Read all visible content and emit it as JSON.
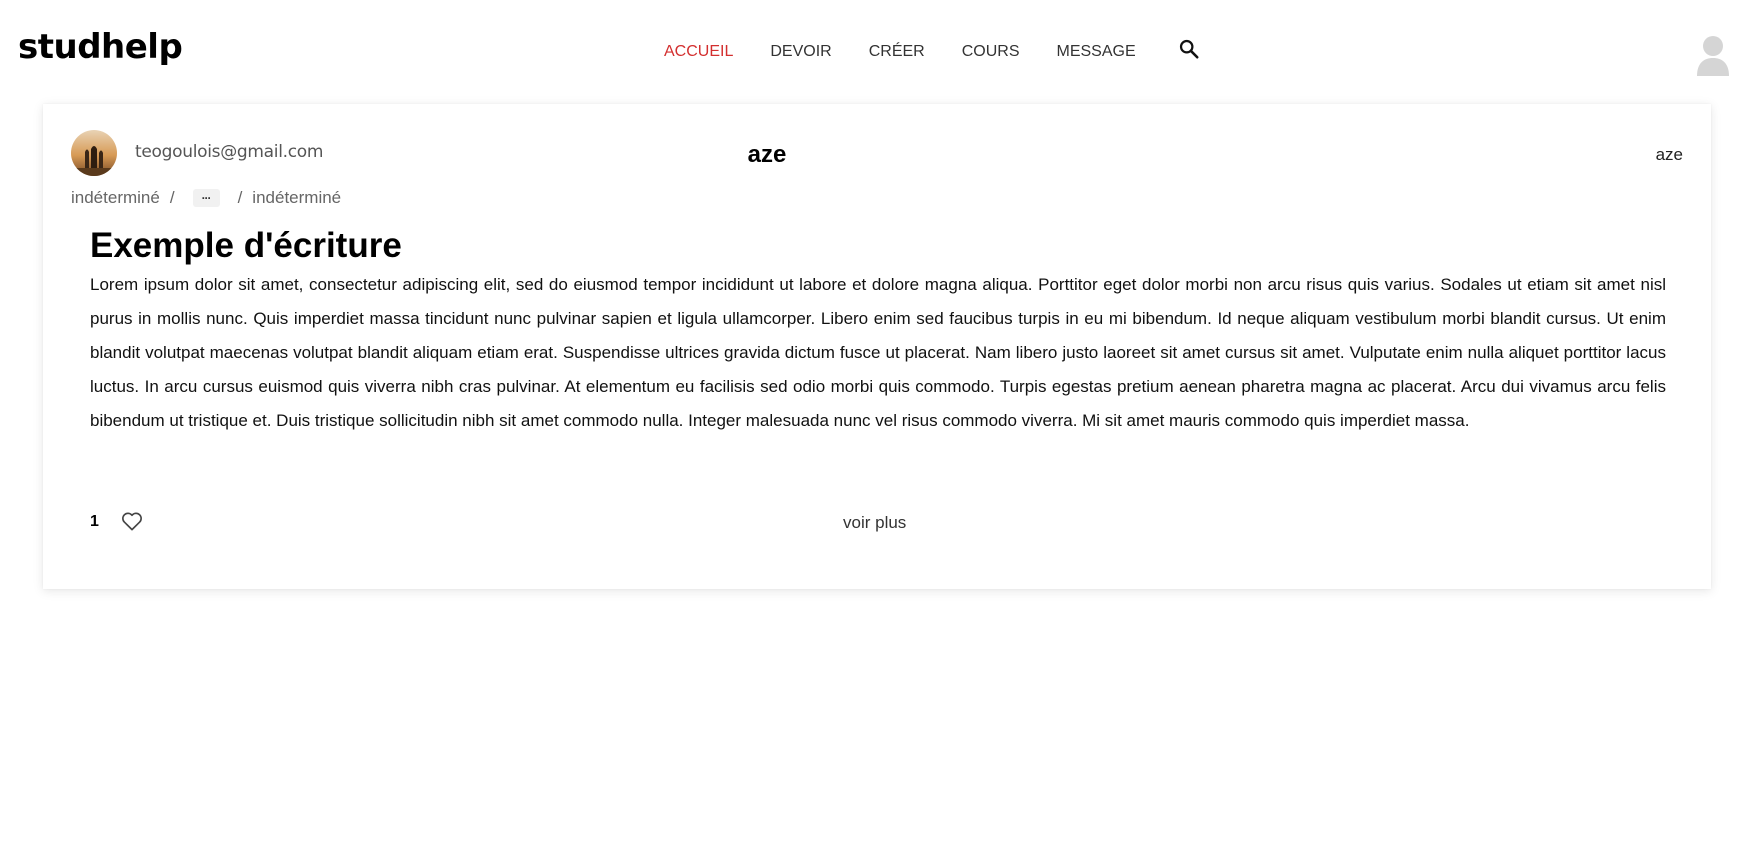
{
  "app": {
    "logo": "studhelp"
  },
  "nav": {
    "items": [
      {
        "label": "ACCUEIL",
        "active": true
      },
      {
        "label": "DEVOIR",
        "active": false
      },
      {
        "label": "CRÉER",
        "active": false
      },
      {
        "label": "COURS",
        "active": false
      },
      {
        "label": "MESSAGE",
        "active": false
      }
    ],
    "active_color": "#d32f2f",
    "search_icon": "search-icon",
    "user_icon": "user-avatar-icon"
  },
  "post": {
    "author_email": "teogoulois@gmail.com",
    "title": "aze",
    "tag": "aze",
    "breadcrumb": {
      "first": "indéterminé",
      "more": "···",
      "last": "indéterminé"
    },
    "heading": "Exemple d'écriture",
    "body": "Lorem ipsum dolor sit amet, consectetur adipiscing elit, sed do eiusmod tempor incididunt ut labore et dolore magna aliqua. Porttitor eget dolor morbi non arcu risus quis varius. Sodales ut etiam sit amet nisl purus in mollis nunc. Quis imperdiet massa tincidunt nunc pulvinar sapien et ligula ullamcorper. Libero enim sed faucibus turpis in eu mi bibendum. Id neque aliquam vestibulum morbi blandit cursus. Ut enim blandit volutpat maecenas volutpat blandit aliquam etiam erat. Suspendisse ultrices gravida dictum fusce ut placerat. Nam libero justo laoreet sit amet cursus sit amet. Vulputate enim nulla aliquet porttitor lacus luctus. In arcu cursus euismod quis viverra nibh cras pulvinar. At elementum eu facilisis sed odio morbi quis commodo. Turpis egestas pretium aenean pharetra magna ac placerat. Arcu dui vivamus arcu felis bibendum ut tristique et. Duis tristique sollicitudin nibh sit amet commodo nulla. Integer malesuada nunc vel risus commodo viverra. Mi sit amet mauris commodo quis imperdiet massa.",
    "likes": "1",
    "like_icon": "heart-icon",
    "more_link": "voir plus"
  }
}
